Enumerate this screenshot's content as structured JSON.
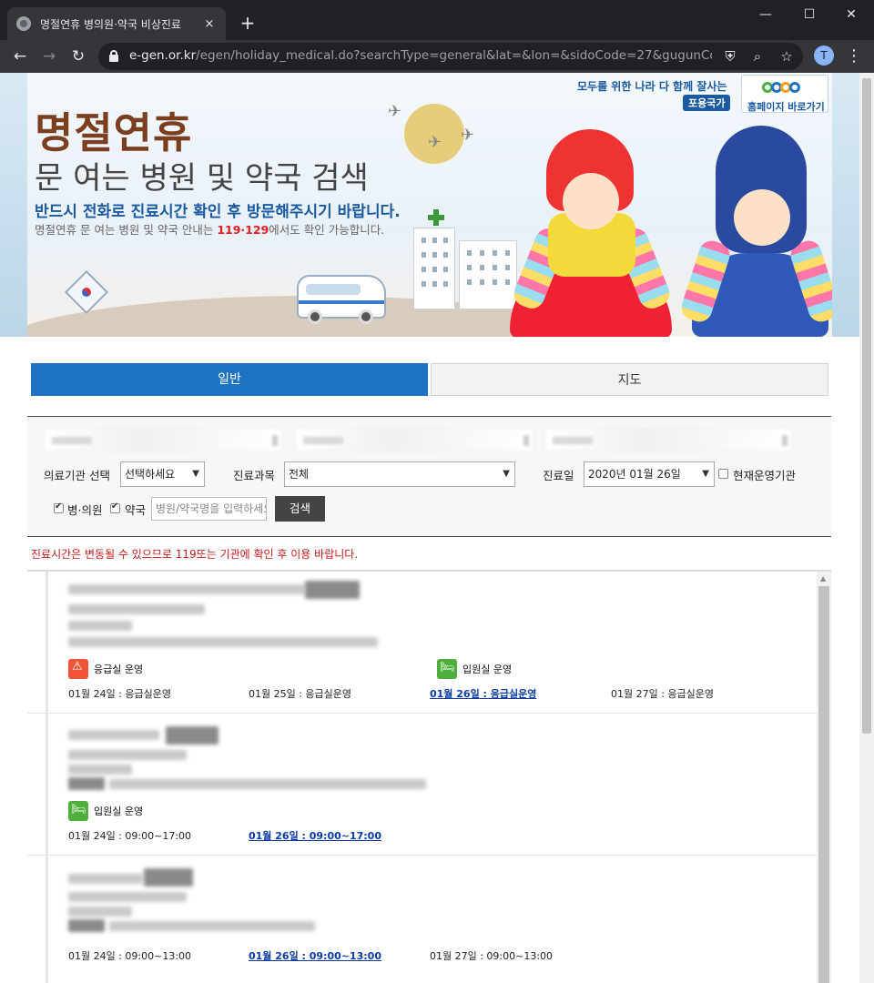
{
  "browser": {
    "tab_title": "명절연휴 병의원·약국 비상진료",
    "tab_close": "×",
    "new_tab": "+",
    "window": {
      "minimize": "—",
      "maximize": "☐",
      "close": "✕"
    },
    "nav": {
      "back": "←",
      "forward": "→",
      "reload": "↻"
    },
    "url_host": "e-gen.or.kr",
    "url_path": "/egen/holiday_medical.do?searchType=general&lat=&lon=&sidoCode=27&gugunCode=2...",
    "profile_initial": "T",
    "icons": [
      "lock-icon",
      "shield-icon",
      "zoom-icon",
      "star-icon",
      "menu-icon"
    ]
  },
  "banner": {
    "title": "명절연휴",
    "subtitle": "문 여는 병원 및 약국 검색",
    "notice": "반드시 전화로 진료시간 확인 후 방문해주시기 바랍니다.",
    "info_prefix": "명절연휴 문 여는 병원 및 약국 안내는 ",
    "info_numbers": "119·129",
    "info_suffix": "에서도 확인 가능합니다.",
    "tagline": "모두를 위한 나라 다 함께 잘사는",
    "badge": "포용국가",
    "homepage_link": "홈페이지 바로가기"
  },
  "tabs": {
    "general": "일반",
    "map": "지도"
  },
  "form": {
    "institution_label": "의료기관 선택",
    "institution_value": "선택하세요",
    "department_label": "진료과목",
    "department_value": "전체",
    "date_label": "진료일",
    "date_value": "2020년 01월 26일",
    "operating_label": "현재운영기관",
    "hospital_label": "병·의원",
    "pharmacy_label": "약국",
    "keyword_placeholder": "병원/약국명을 입력하세요",
    "search_button": "검색"
  },
  "notice": "진료시간은 변동될 수 있으므로 119또는 기관에 확인 후 이용 바랍니다.",
  "results": [
    {
      "services": [
        "응급실 운영",
        "입원실 운영"
      ],
      "days": [
        "01월 24일 : 응급실운영",
        "01월 25일 : 응급실운영",
        "01월 26일 : 응급실운영",
        "01월 27일 : 응급실운영"
      ],
      "today_index": 2
    },
    {
      "services": [
        "입원실 운영"
      ],
      "days": [
        "01월 24일 : 09:00~17:00",
        "01월 26일 : 09:00~17:00"
      ],
      "today_index": 1
    },
    {
      "services": [],
      "days": [
        "01월 24일 : 09:00~13:00",
        "01월 26일 : 09:00~13:00",
        "01월 27일 : 09:00~13:00"
      ],
      "today_index": 1
    }
  ],
  "colors": {
    "accent_blue": "#1e73c2",
    "title_brown": "#7b3f1f",
    "notice_red": "#c41a1a",
    "er_orange": "#f0553a",
    "bed_green": "#4fae3c"
  }
}
